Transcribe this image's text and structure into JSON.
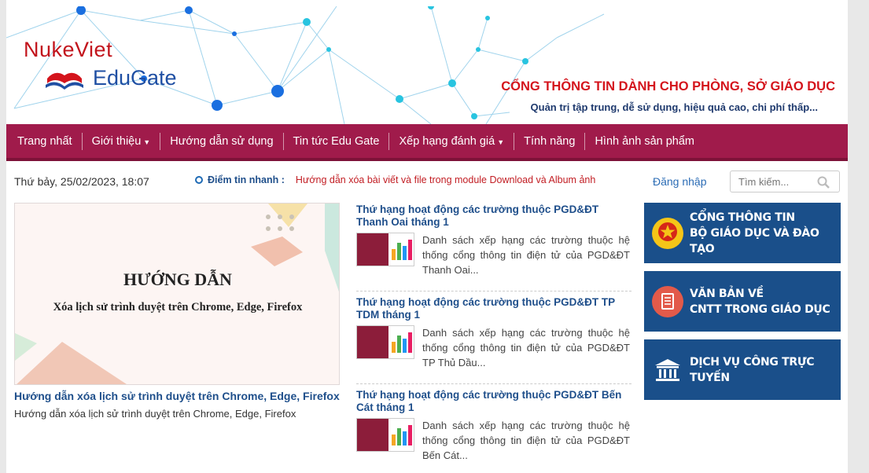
{
  "header": {
    "logo_line1": "NukeViet",
    "logo_line2": "EduGate",
    "tagline": "CỔNG THÔNG TIN DÀNH CHO PHÒNG, SỞ GIÁO DỤC",
    "subtagline": "Quản trị tập trung, dễ sử dụng, hiệu quả cao, chi phí thấp...",
    "accent": "#d4141c"
  },
  "menu": {
    "color": "#a01b4b",
    "items": [
      {
        "label": "Trang nhất"
      },
      {
        "label": "Giới thiệu",
        "dropdown": true
      },
      {
        "label": "Hướng dẫn sử dụng"
      },
      {
        "label": "Tin tức Edu Gate"
      },
      {
        "label": "Xếp hạng đánh giá",
        "dropdown": true
      },
      {
        "label": "Tính năng"
      },
      {
        "label": "Hình ảnh sản phẩm"
      }
    ]
  },
  "infobar": {
    "date": "Thứ bảy, 25/02/2023, 18:07",
    "quick_label": "Điểm tin nhanh :",
    "quick_news": "Hướng dẫn xóa bài viết và file trong module Download và Album ảnh",
    "login": "Đăng nhập",
    "search_placeholder": "Tìm kiếm..."
  },
  "feature": {
    "image_heading": "HƯỚNG DẪN",
    "image_subheading": "Xóa lịch sử trình duyệt trên Chrome, Edge, Firefox",
    "title": "Hướng dẫn xóa lịch sử trình duyệt trên Chrome, Edge, Firefox",
    "desc": "Hướng dẫn xóa lịch sử trình duyệt trên Chrome, Edge, Firefox"
  },
  "articles": [
    {
      "title": "Thứ hạng hoạt động các trường thuộc PGD&ĐT Thanh Oai tháng 1",
      "desc": "Danh sách xếp hạng các trường thuộc hệ thống cổng thông tin điện tử của PGD&ĐT Thanh Oai..."
    },
    {
      "title": "Thứ hạng hoạt động các trường thuộc PGD&ĐT TP TDM tháng 1",
      "desc": "Danh sách xếp hạng các trường thuộc hệ thống cổng thông tin điện tử của PGD&ĐT TP Thủ Dầu..."
    },
    {
      "title": "Thứ hạng hoạt động các trường thuộc PGD&ĐT Bến Cát tháng 1",
      "desc": "Danh sách xếp hạng các trường thuộc hệ thống cổng thông tin điện tử của PGD&ĐT Bến Cát..."
    }
  ],
  "banners": [
    {
      "line1": "CỔNG THÔNG TIN",
      "line2": "BỘ GIÁO DỤC VÀ ĐÀO TẠO",
      "icon": "emblem-icon"
    },
    {
      "line1": "VĂN BẢN VỀ",
      "line2": "CNTT TRONG GIÁO DỤC",
      "icon": "document-icon"
    },
    {
      "line1": "DỊCH VỤ CÔNG TRỰC TUYẾN",
      "line2": "",
      "icon": "government-building-icon"
    }
  ]
}
